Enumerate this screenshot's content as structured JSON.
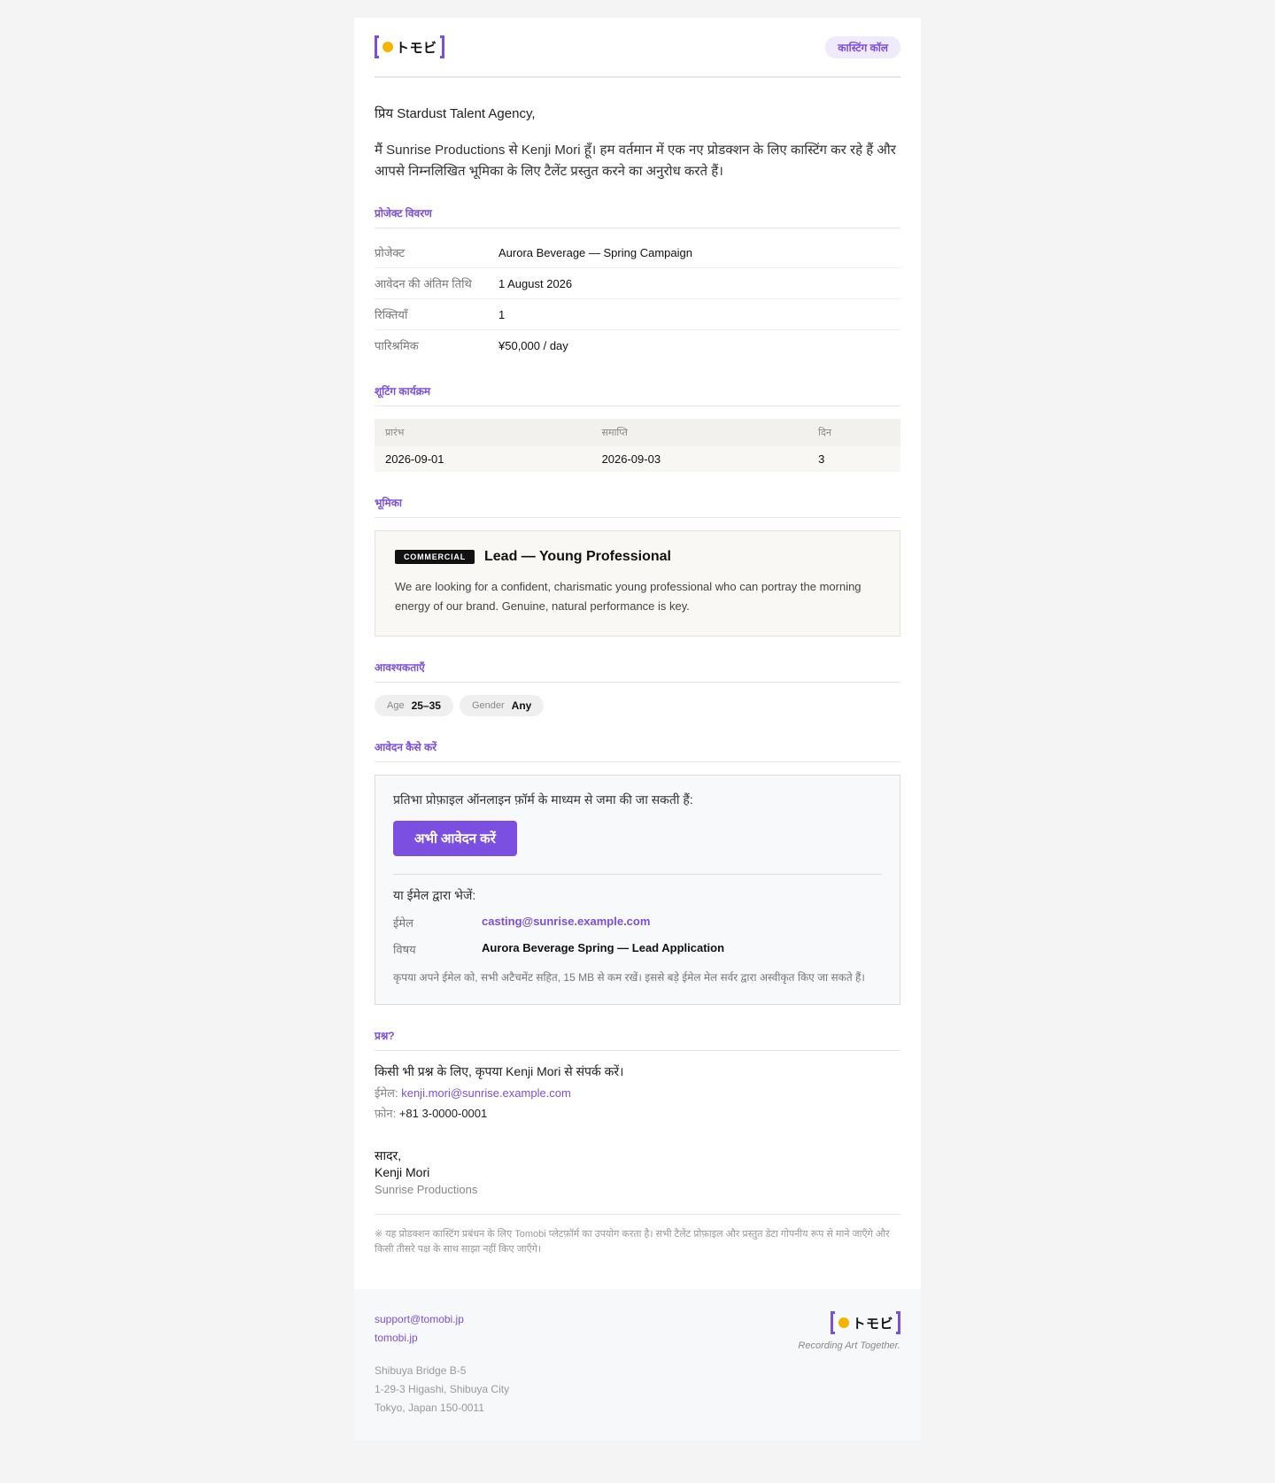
{
  "brand": {
    "logo_text": "トモビ",
    "accent": "#7b4fe0",
    "dot_color": "#f5b400"
  },
  "header": {
    "badge": "कास्टिंग कॉल"
  },
  "greeting": "प्रिय Stardust Talent Agency,",
  "intro": "मैं Sunrise Productions से Kenji Mori हूँ। हम वर्तमान में एक नए प्रोडक्शन के लिए कास्टिंग कर रहे हैं और आपसे निम्नलिखित भूमिका के लिए टैलेंट प्रस्तुत करने का अनुरोध करते हैं।",
  "project_details": {
    "title": "प्रोजेक्ट विवरण",
    "rows": [
      {
        "key": "प्रोजेक्ट",
        "value": "Aurora Beverage — Spring Campaign"
      },
      {
        "key": "आवेदन की अंतिम तिथि",
        "value": "1 August 2026"
      },
      {
        "key": "रिक्तियाँ",
        "value": "1"
      },
      {
        "key": "पारिश्रमिक",
        "value": "¥50,000 / day"
      }
    ]
  },
  "schedule": {
    "title": "शूटिंग कार्यक्रम",
    "headers": [
      "प्रारंभ",
      "समाप्ति",
      "दिन"
    ],
    "row": [
      "2026-09-01",
      "2026-09-03",
      "3"
    ]
  },
  "role": {
    "title": "भूमिका",
    "tag": "COMMERCIAL",
    "name": "Lead — Young Professional",
    "description": "We are looking for a confident, charismatic young professional who can portray the morning energy of our brand. Genuine, natural performance is key."
  },
  "requirements": {
    "title": "आवश्यकताएँ",
    "chips": [
      {
        "key": "Age",
        "value": "25–35"
      },
      {
        "key": "Gender",
        "value": "Any"
      }
    ]
  },
  "apply": {
    "title": "आवेदन कैसे करें",
    "lead": "प्रतिभा प्रोफ़ाइल ऑनलाइन फ़ॉर्म के माध्यम से जमा की जा सकती हैं:",
    "button": "अभी आवेदन करें",
    "or_email": "या ईमेल द्वारा भेजें:",
    "email_label": "ईमेल",
    "email_value": "casting@sunrise.example.com",
    "subject_label": "विषय",
    "subject_value": "Aurora Beverage Spring — Lead Application",
    "note": "कृपया अपने ईमेल को, सभी अटैचमेंट सहित, 15 MB से कम रखें। इससे बड़े ईमेल मेल सर्वर द्वारा अस्वीकृत किए जा सकते हैं।"
  },
  "questions": {
    "title": "प्रश्न?",
    "text": "किसी भी प्रश्न के लिए, कृपया Kenji Mori से संपर्क करें।",
    "email_label": "ईमेल:",
    "email": "kenji.mori@sunrise.example.com",
    "phone_label": "फ़ोन:",
    "phone": "+81 3-0000-0001"
  },
  "signature": {
    "closing": "सादर,",
    "name": "Kenji Mori",
    "company": "Sunrise Productions"
  },
  "disclaimer": "※ यह प्रोडक्शन कास्टिंग प्रबंधन के लिए Tomobi प्लेटफ़ॉर्म का उपयोग करता है। सभी टैलेंट प्रोफ़ाइल और प्रस्तुत डेटा गोपनीय रूप से माने जाएँगे और किसी तीसरे पक्ष के साथ साझा नहीं किए जाएँगे।",
  "footer": {
    "support_email": "support@tomobi.jp",
    "site": "tomobi.jp",
    "address": [
      "Shibuya Bridge B-5",
      "1-29-3 Higashi, Shibuya City",
      "Tokyo, Japan 150-0011"
    ],
    "tagline": "Recording Art Together."
  }
}
